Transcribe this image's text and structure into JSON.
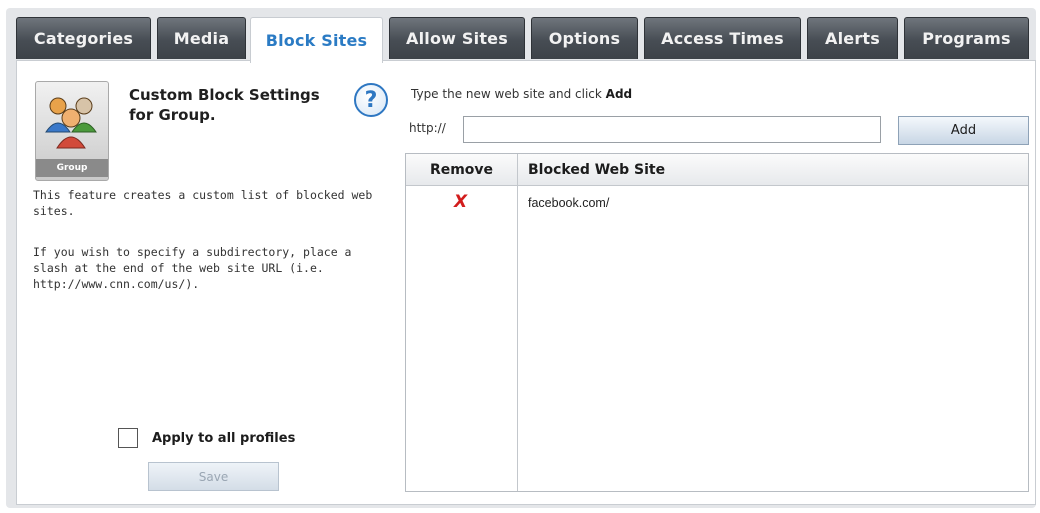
{
  "tabs": [
    {
      "label": "Categories"
    },
    {
      "label": "Media"
    },
    {
      "label": "Block Sites"
    },
    {
      "label": "Allow Sites"
    },
    {
      "label": "Options"
    },
    {
      "label": "Access Times"
    },
    {
      "label": "Alerts"
    },
    {
      "label": "Programs"
    }
  ],
  "active_tab": "Block Sites",
  "left_panel": {
    "icon_name": "group-users-icon",
    "icon_caption": "Group",
    "title": "Custom Block Settings for Group.",
    "description_1": "This feature creates a custom list of blocked web sites.",
    "description_2": "If you wish to specify a subdirectory, place a slash at the end of the web site URL (i.e. http://www.cnn.com/us/).",
    "apply_label": "Apply to all profiles",
    "apply_checked": false,
    "save_label": "Save"
  },
  "help_icon": "?",
  "add_form": {
    "instruction_prefix": "Type the new web site and click",
    "instruction_action": "Add",
    "url_prefix": "http://",
    "url_value": "",
    "add_label": "Add"
  },
  "table": {
    "col_remove": "Remove",
    "col_site": "Blocked Web Site",
    "rows": [
      {
        "remove": "X",
        "site": "facebook.com/"
      }
    ]
  },
  "colors": {
    "active_tab_text": "#2b7bc4",
    "remove_icon": "#d21c1c"
  }
}
